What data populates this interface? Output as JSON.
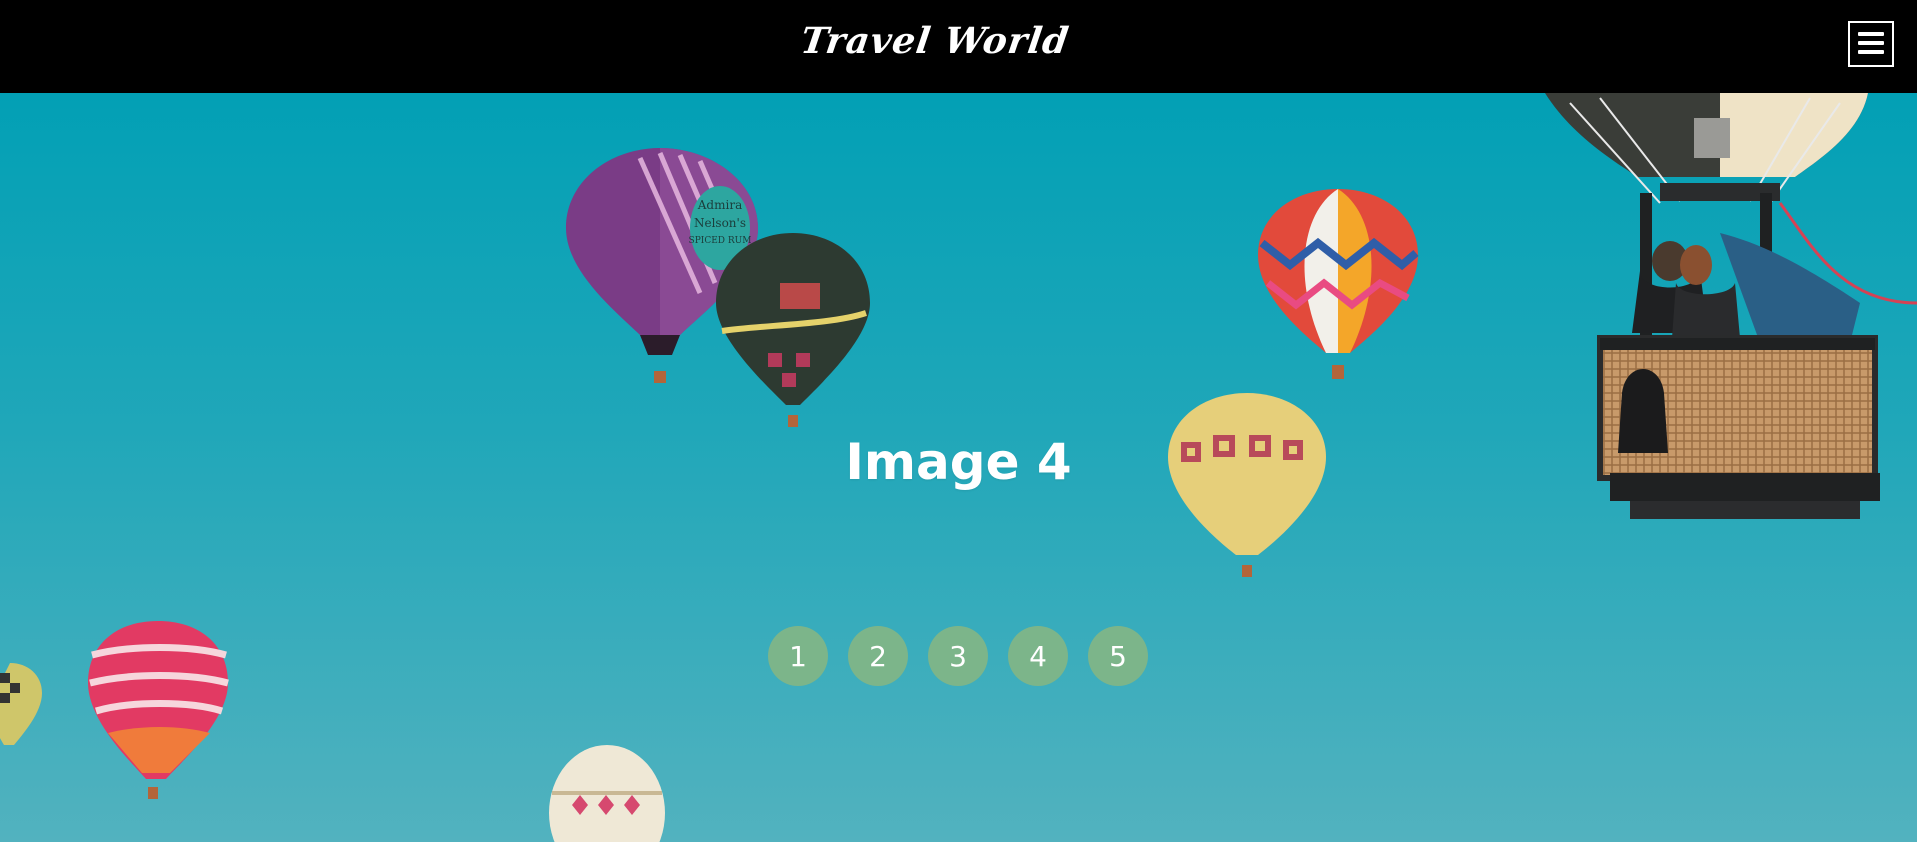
{
  "header": {
    "brand": "Travel World",
    "menu_icon": "hamburger-menu-icon"
  },
  "slider": {
    "title": "Image 4",
    "active_index": 4,
    "dots": [
      {
        "label": "1"
      },
      {
        "label": "2"
      },
      {
        "label": "3"
      },
      {
        "label": "4"
      },
      {
        "label": "5"
      }
    ]
  },
  "colors": {
    "header_bg": "#000000",
    "sky_top": "#02a0b5",
    "sky_bottom": "#52b2bf",
    "dot": "#7cb58a",
    "text": "#ffffff"
  }
}
